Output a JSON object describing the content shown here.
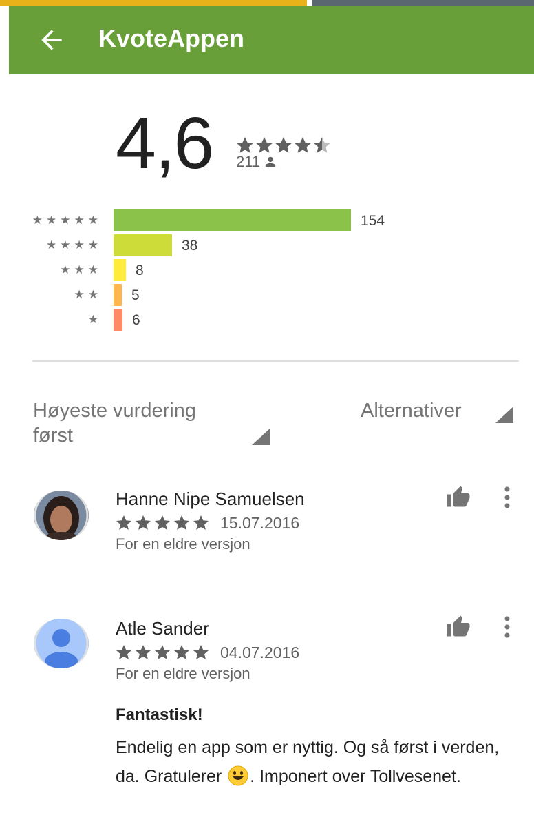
{
  "app_bar": {
    "title": "KvoteAppen",
    "back_icon": "arrow-back-icon",
    "color": "#689f38"
  },
  "summary": {
    "rating": "4,6",
    "rating_stars_value": 4.6,
    "review_count": "211"
  },
  "histogram": [
    {
      "stars": "★★★★★",
      "count": "154",
      "value": 154,
      "color": "#8bc34a"
    },
    {
      "stars": "★★★★",
      "count": "38",
      "value": 38,
      "color": "#cddc39"
    },
    {
      "stars": "★★★",
      "count": "8",
      "value": 8,
      "color": "#ffeb3b"
    },
    {
      "stars": "★★",
      "count": "5",
      "value": 5,
      "color": "#ffb74d"
    },
    {
      "stars": "★",
      "count": "6",
      "value": 6,
      "color": "#ff8a65"
    }
  ],
  "sort": {
    "label": "Høyeste vurdering først",
    "options_label": "Alternativer"
  },
  "reviews": [
    {
      "name": "Hanne Nipe Samuelsen",
      "stars": 5,
      "date": "15.07.2016",
      "version_note": "For en eldre versjon"
    },
    {
      "name": "Atle Sander",
      "stars": 5,
      "date": "04.07.2016",
      "version_note": "For en eldre versjon",
      "title": "Fantastisk!",
      "body_1": "Endelig en app som er nyttig. Og så først i verden, da. Gratulerer",
      "body_2": ". Imponert over Tollvesenet."
    }
  ]
}
